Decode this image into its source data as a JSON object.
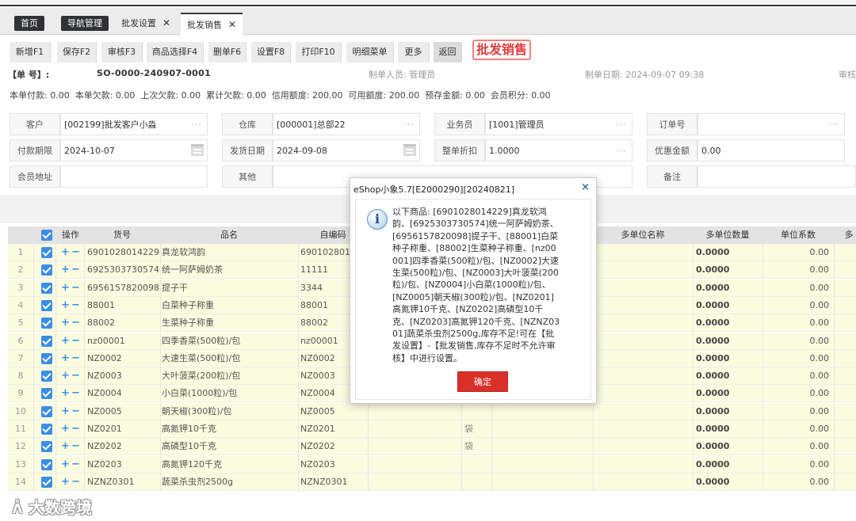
{
  "tabs": [
    {
      "label": "首页",
      "closable": false,
      "style": "dark"
    },
    {
      "label": "导航管理",
      "closable": false,
      "style": "dark"
    },
    {
      "label": "批发设置",
      "closable": true,
      "style": "plain"
    },
    {
      "label": "批发销售",
      "closable": true,
      "style": "active"
    }
  ],
  "toolbar": {
    "buttons": [
      "新增F1",
      "保存F2",
      "审核F3",
      "商品选择F4",
      "删单F6",
      "设置F8",
      "打印F10",
      "明细菜单",
      "更多",
      "返回"
    ],
    "mode_label": "批发销售"
  },
  "header": {
    "order_label": "【单 号】:",
    "order_no": "SO-0000-240907-0001",
    "maker": "制单人员: 管理员",
    "make_date": "制单日期: 2024-09-07 09:38",
    "audit": "审核"
  },
  "amounts": [
    "本单付款: 0.00",
    "本单欠款: 0.00",
    "上次欠款: 0.00",
    "累计欠款: 0.00",
    "信用额度: 200.00",
    "可用额度: 200.00",
    "预存金额: 0.00",
    "会员积分: 0.00"
  ],
  "form": {
    "customer_label": "客户",
    "customer_value": "[002199]批发客户小淼",
    "warehouse_label": "仓库",
    "warehouse_value": "[000001]总部22",
    "salesman_label": "业务员",
    "salesman_value": "[1001]管理员",
    "order_label": "订单号",
    "order_value": "",
    "paydue_label": "付款期限",
    "paydue_value": "2024-10-07",
    "shipdate_label": "发货日期",
    "shipdate_value": "2024-09-08",
    "discount_label": "整单折扣",
    "discount_value": "1.0000",
    "offer_label": "优惠金额",
    "offer_value": "0.00",
    "address_label": "会员地址",
    "address_value": "",
    "other_label": "其他",
    "other_value": "",
    "remark_label": "备注",
    "remark_value": ""
  },
  "table": {
    "headers": {
      "op": "操作",
      "code": "货号",
      "name": "品名",
      "selfcode": "自编码",
      "multiunit_name": "多单位名称",
      "multiunit_qty": "多单位数量",
      "unit_factor": "单位系数",
      "more": "多"
    },
    "rows": [
      {
        "idx": "1",
        "code": "6901028014229",
        "name": "真龙软鸿韵",
        "selfcode": "6901028014",
        "bag": "",
        "qty": "0.0000",
        "factor": "0.00"
      },
      {
        "idx": "2",
        "code": "6925303730574",
        "name": "统一阿萨姆奶茶",
        "selfcode": "11111",
        "bag": "",
        "qty": "0.0000",
        "factor": "0.00"
      },
      {
        "idx": "3",
        "code": "6956157820098",
        "name": "提子干",
        "selfcode": "3344",
        "bag": "",
        "qty": "0.0000",
        "factor": "0.00"
      },
      {
        "idx": "4",
        "code": "88001",
        "name": "白菜种子称重",
        "selfcode": "88001",
        "bag": "",
        "qty": "0.0000",
        "factor": "0.00"
      },
      {
        "idx": "5",
        "code": "88002",
        "name": "生菜种子称重",
        "selfcode": "88002",
        "bag": "",
        "qty": "0.0000",
        "factor": "0.00"
      },
      {
        "idx": "6",
        "code": "nz00001",
        "name": "四季香菜(500粒)/包",
        "selfcode": "nz00001",
        "bag": "",
        "qty": "0.0000",
        "factor": "0.00"
      },
      {
        "idx": "7",
        "code": "NZ0002",
        "name": "大速生菜(500粒)/包",
        "selfcode": "NZ0002",
        "bag": "",
        "qty": "0.0000",
        "factor": "0.00"
      },
      {
        "idx": "8",
        "code": "NZ0003",
        "name": "大叶菠菜(200粒)/包",
        "selfcode": "NZ0003",
        "bag": "",
        "qty": "0.0000",
        "factor": "0.00"
      },
      {
        "idx": "9",
        "code": "NZ0004",
        "name": "小白菜(1000粒)/包",
        "selfcode": "NZ0004",
        "bag": "",
        "qty": "0.0000",
        "factor": "0.00"
      },
      {
        "idx": "10",
        "code": "NZ0005",
        "name": "朝天椒(300粒)/包",
        "selfcode": "NZ0005",
        "bag": "",
        "qty": "0.0000",
        "factor": "0.00"
      },
      {
        "idx": "11",
        "code": "NZ0201",
        "name": "高氮钾10千克",
        "selfcode": "NZ0201",
        "bag": "袋",
        "qty": "0.0000",
        "factor": "0.00"
      },
      {
        "idx": "12",
        "code": "NZ0202",
        "name": "高磷型10千克",
        "selfcode": "NZ0202",
        "bag": "袋",
        "qty": "0.0000",
        "factor": "0.00"
      },
      {
        "idx": "13",
        "code": "NZ0203",
        "name": "高氮钾120千克",
        "selfcode": "NZ0203",
        "bag": "",
        "qty": "0.0000",
        "factor": "0.00"
      },
      {
        "idx": "14",
        "code": "NZNZ0301",
        "name": "蔬菜杀虫剂2500g",
        "selfcode": "NZNZ0301",
        "bag": "",
        "qty": "0.0000",
        "factor": "0.00"
      }
    ]
  },
  "dialog": {
    "title": "eShop小象5.7[E2000290][20240821]",
    "close": "×",
    "message": "以下商品: [6901028014229]真龙软鸿韵、[6925303730574]统一阿萨姆奶茶、[6956157820098]提子干、[88001]白菜种子称重、[88002]生菜种子称重、[nz00001]四季香菜(500粒)/包、[NZ0002]大速生菜(500粒)/包、[NZ0003]大叶菠菜(200粒)/包、[NZ0004]小白菜(1000粒)/包、[NZ0005]朝天椒(300粒)/包、[NZ0201]高氮钾10千克、[NZ0202]高磷型10千克、[NZ0203]高氮钾120千克、[NZNZ0301]蔬菜杀虫剂2500g,库存不足!可在【批发设置】-【批发销售,库存不足时不允许审核】中进行设置。",
    "ok": "确定",
    "icon": "info-icon"
  },
  "watermark": {
    "text": "大数跨境",
    "icon": "logo-icon"
  },
  "colors": {
    "accent": "#3a8ee6",
    "danger": "#d9302a",
    "row_bg": "#fbfbe0",
    "badge": "#e03c3c"
  }
}
